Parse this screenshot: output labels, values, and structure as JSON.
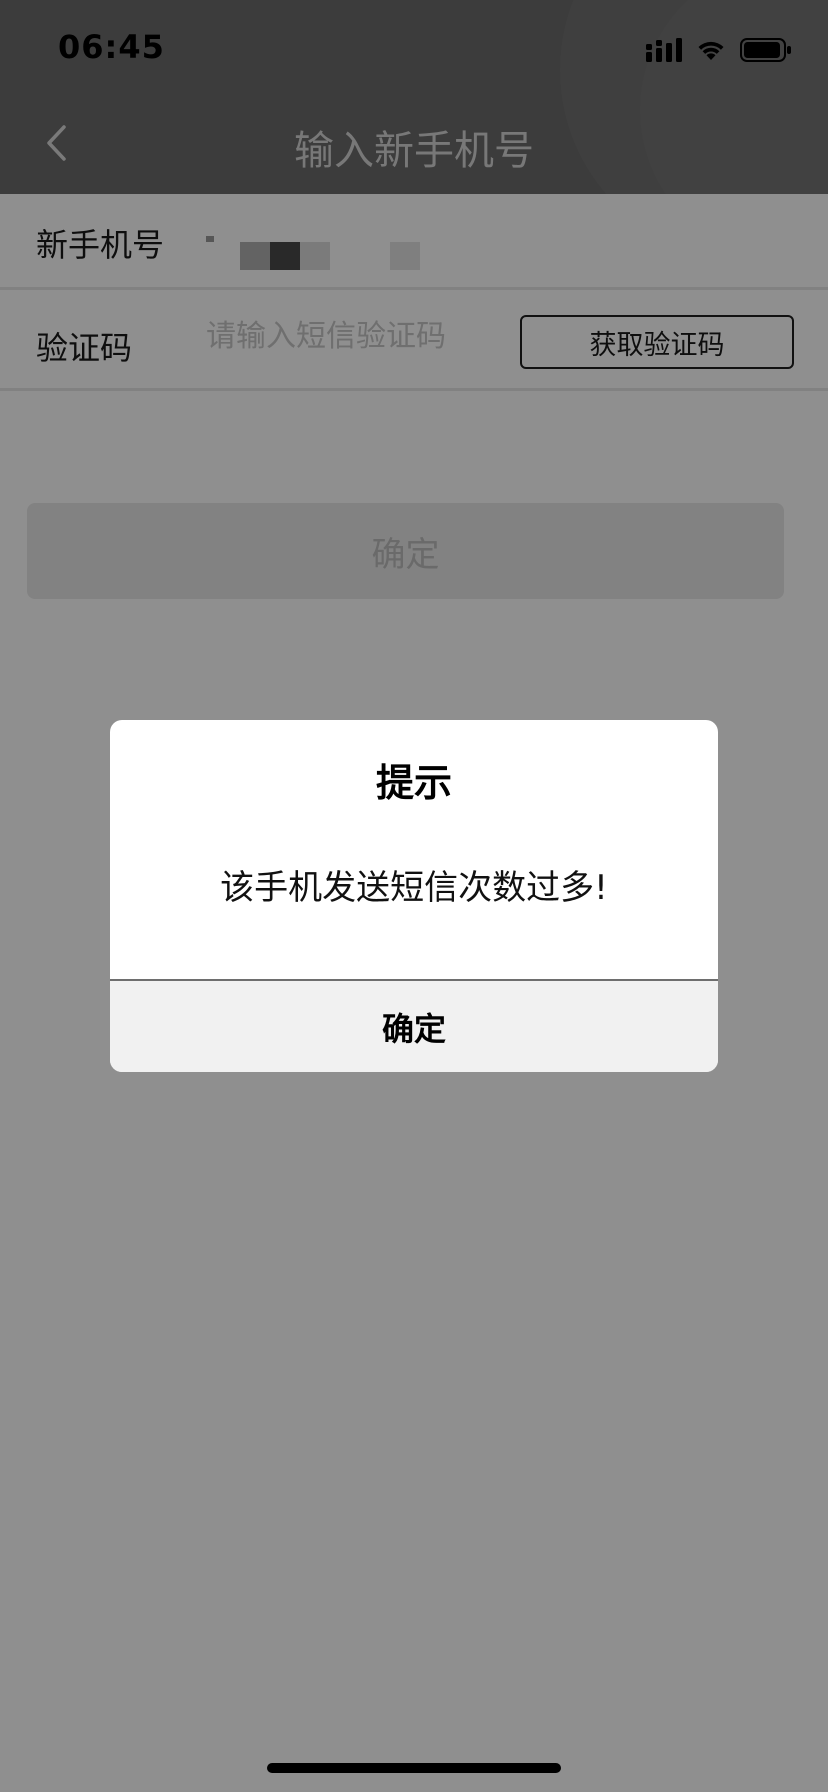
{
  "status_bar": {
    "time": "06:45",
    "icons": [
      "signal-icon",
      "wifi-icon",
      "battery-icon"
    ]
  },
  "nav": {
    "back_icon": "chevron-left-icon",
    "title": "输入新手机号"
  },
  "form": {
    "phone_label": "新手机号",
    "phone_value": "",
    "code_label": "验证码",
    "code_placeholder": "请输入短信验证码",
    "get_code_label": "获取验证码"
  },
  "confirm_button_label": "确定",
  "dialog": {
    "title": "提示",
    "message": "该手机发送短信次数过多!",
    "button_label": "确定"
  },
  "colors": {
    "header_bg": "#6b6b6b",
    "overlay": "rgba(0,0,0,0.44)",
    "dialog_button_bg": "#f1f1f1"
  }
}
